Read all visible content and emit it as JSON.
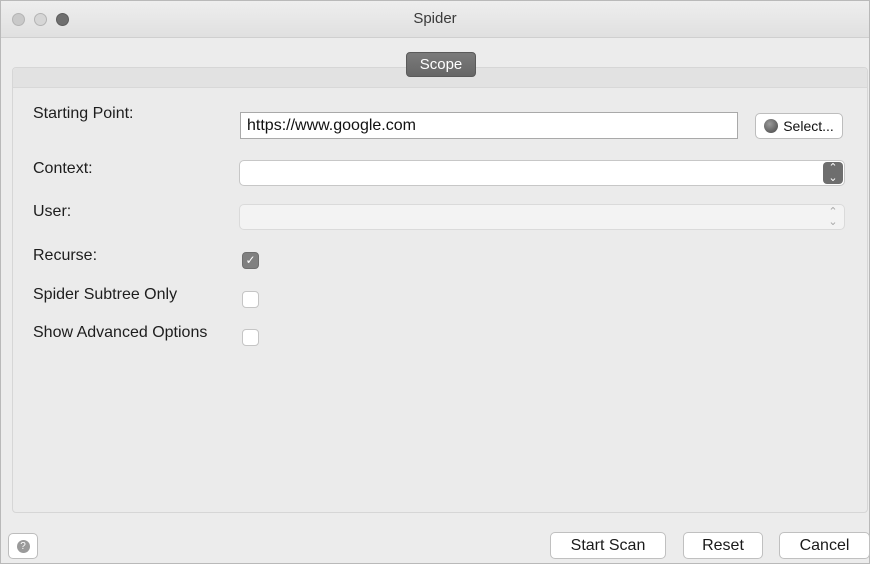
{
  "window": {
    "title": "Spider"
  },
  "tabs": [
    {
      "label": "Scope",
      "selected": true
    }
  ],
  "form": {
    "starting_point": {
      "label": "Starting Point:",
      "value": "https://www.google.com",
      "select_label": "Select..."
    },
    "context": {
      "label": "Context:",
      "value": ""
    },
    "user": {
      "label": "User:",
      "value": "",
      "enabled": false
    },
    "recurse": {
      "label": "Recurse:",
      "checked": true
    },
    "subtree_only": {
      "label": "Spider Subtree Only",
      "checked": false
    },
    "advanced": {
      "label": "Show Advanced Options",
      "checked": false
    }
  },
  "buttons": {
    "start": "Start Scan",
    "reset": "Reset",
    "cancel": "Cancel"
  },
  "icons": {
    "help": "help-icon",
    "globe": "globe-icon",
    "checkmark": "✓"
  },
  "colors": {
    "tab_bg": "#707070",
    "checked_bg": "#808080"
  }
}
